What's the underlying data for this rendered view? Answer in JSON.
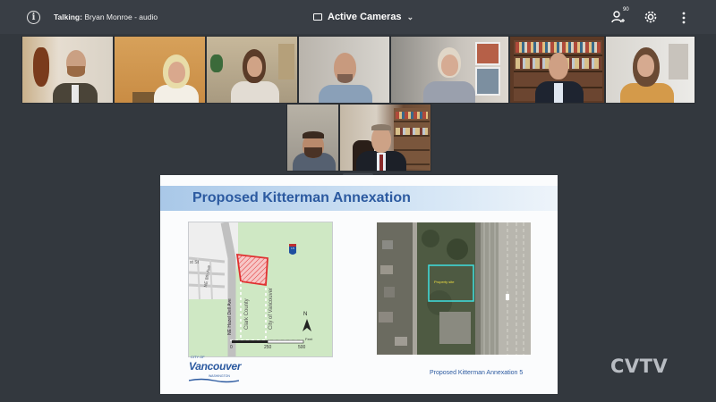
{
  "topbar": {
    "talking_label": "Talking:",
    "talking_value": "Bryan Monroe - audio",
    "view_label": "Active Cameras",
    "participant_count": "90"
  },
  "icons": {
    "info": "info-icon",
    "camera": "camera-icon",
    "chevron": "chevron-down-icon",
    "participants": "participants-icon",
    "settings": "gear-icon",
    "more": "more-vertical-icon"
  },
  "slide": {
    "title": "Proposed Kitterman Annexation",
    "footer": "Proposed Kitterman Annexation   5",
    "logo_small": "CITY OF",
    "logo": "Vancouver",
    "logo_sub": "WASHINGTON",
    "map": {
      "street_ne8": "NE 8th Ave",
      "street_hazel": "NE Hazel Dell Ave",
      "label_clark": "Clark County",
      "label_city": "City of Vancouver",
      "street_st": "st St",
      "north": "N",
      "scale_0": "0",
      "scale_250": "250",
      "scale_500": "500",
      "scale_unit": "Feet",
      "highway_shield": "I-5"
    },
    "aerial_label": "Property site"
  },
  "brand": {
    "watermark": "CVTV"
  },
  "colors": {
    "background": "#33383e",
    "topbar": "#393e45",
    "slide_title": "#2c5aa0",
    "annex_parcel": "#e03030",
    "aerial_box": "#3fe0e0"
  }
}
